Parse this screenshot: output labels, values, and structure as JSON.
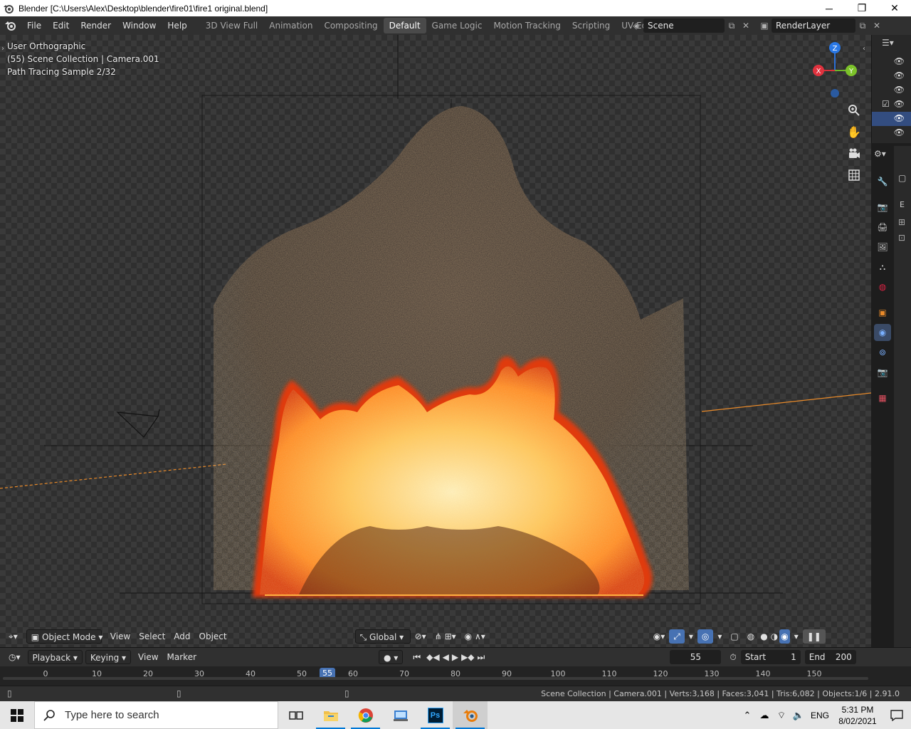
{
  "window": {
    "title": "Blender [C:\\Users\\Alex\\Desktop\\blender\\fire01\\fire1 original.blend]",
    "minimize": "─",
    "maximize": "❐",
    "close": "✕"
  },
  "menu": [
    "File",
    "Edit",
    "Render",
    "Window",
    "Help"
  ],
  "workspaces": [
    {
      "label": "3D View Full",
      "active": false
    },
    {
      "label": "Animation",
      "active": false
    },
    {
      "label": "Compositing",
      "active": false
    },
    {
      "label": "Default",
      "active": true
    },
    {
      "label": "Game Logic",
      "active": false
    },
    {
      "label": "Motion Tracking",
      "active": false
    },
    {
      "label": "Scripting",
      "active": false
    },
    {
      "label": "UV Editing",
      "active": false
    },
    {
      "label": "V",
      "active": false
    }
  ],
  "scene": {
    "name": "Scene",
    "render_layer": "RenderLayer"
  },
  "viewport": {
    "view_name": "User Orthographic",
    "collection_info": "(55) Scene Collection | Camera.001",
    "render_status": "Path Tracing Sample 2/32",
    "axis_x": "X",
    "axis_y": "Y",
    "axis_z": "Z"
  },
  "viewport_header": {
    "mode": "Object Mode",
    "menus": [
      "View",
      "Select",
      "Add",
      "Object"
    ],
    "orientation": "Global"
  },
  "timeline": {
    "menus": [
      "Playback",
      "Keying",
      "View",
      "Marker"
    ],
    "current_frame": "55",
    "start_label": "Start",
    "start": "1",
    "end_label": "End",
    "end": "200",
    "ticks": [
      "0",
      "10",
      "20",
      "30",
      "40",
      "50",
      "60",
      "70",
      "80",
      "90",
      "100",
      "110",
      "120",
      "130",
      "140",
      "150"
    ]
  },
  "status": {
    "text": "Scene Collection | Camera.001 | Verts:3,168 | Faces:3,041 | Tris:6,082 | Objects:1/6 | 2.91.0"
  },
  "properties": {
    "panel_letter": "E"
  },
  "taskbar": {
    "search_placeholder": "Type here to search",
    "language": "ENG",
    "time": "5:31 PM",
    "date": "8/02/2021",
    "ps_label": "Ps"
  },
  "colors": {
    "accent": "#4772b3",
    "fire_core": "#fff2b0",
    "fire_mid": "#ff9a2a",
    "fire_edge": "#e03a10",
    "selection_orange": "#e88a2a"
  }
}
